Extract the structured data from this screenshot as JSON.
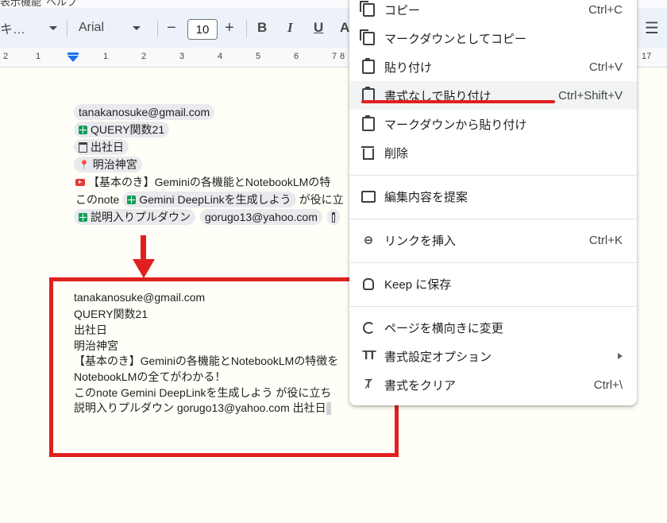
{
  "topstrip": {
    "left_text": "表示機能",
    "mid_text": "ヘルプ"
  },
  "toolbar": {
    "style_label": "キ…",
    "font_label": "Arial",
    "decrease": "−",
    "font_size": "10",
    "increase": "+",
    "bold": "B",
    "italic": "I",
    "underline": "U",
    "text_color": "A",
    "checklist_icon": "checklist-icon"
  },
  "ruler": {
    "numbers": [
      "2",
      "1",
      "1",
      "2",
      "3",
      "4",
      "5",
      "6",
      "7",
      "8",
      "17"
    ]
  },
  "document": {
    "smart_chips": {
      "email": "tanakanosuke@gmail.com",
      "sheet1": "QUERY関数21",
      "date": "出社日",
      "place": "明治神宮",
      "video": "【基本のき】Geminiの各機能とNotebookLMの特",
      "line6_prefix": "このnote",
      "doc_link": "Gemini DeepLinkを生成しよう",
      "line6_suffix": "が役に立",
      "sheet2": "説明入りプルダウン",
      "email2": "gorugo13@yahoo.com"
    },
    "pasted_lines": [
      "tanakanosuke@gmail.com",
      "QUERY関数21",
      "出社日",
      "明治神宮",
      "【基本のき】Geminiの各機能とNotebookLMの特徴を",
      "NotebookLMの全てがわかる！",
      "このnote Gemini DeepLinkを生成しよう が役に立ち",
      "説明入りプルダウン gorugo13@yahoo.com 出社日"
    ]
  },
  "context_menu": {
    "items": [
      {
        "icon": "copy-icon",
        "label": "コピー",
        "shortcut": "Ctrl+C"
      },
      {
        "icon": "markdown-copy-icon",
        "label": "マークダウンとしてコピー",
        "shortcut": ""
      },
      {
        "icon": "paste-icon",
        "label": "貼り付け",
        "shortcut": "Ctrl+V"
      },
      {
        "icon": "paste-plain-icon",
        "label": "書式なしで貼り付け",
        "shortcut": "Ctrl+Shift+V"
      },
      {
        "icon": "markdown-paste-icon",
        "label": "マークダウンから貼り付け",
        "shortcut": ""
      },
      {
        "icon": "trash-icon",
        "label": "削除",
        "shortcut": ""
      },
      {
        "icon": "suggest-edit-icon",
        "label": "編集内容を提案",
        "shortcut": ""
      },
      {
        "icon": "link-icon",
        "label": "リンクを挿入",
        "shortcut": "Ctrl+K"
      },
      {
        "icon": "keep-icon",
        "label": "Keep に保存",
        "shortcut": ""
      },
      {
        "icon": "rotate-icon",
        "label": "ページを横向きに変更",
        "shortcut": ""
      },
      {
        "icon": "format-icon",
        "label": "書式設定オプション",
        "shortcut": ""
      },
      {
        "icon": "clear-format-icon",
        "label": "書式をクリア",
        "shortcut": "Ctrl+\\"
      }
    ]
  },
  "colors": {
    "annotation_red": "#e02020",
    "toolbar_bg": "#edf2fa",
    "chip_bg": "#e8eaed"
  }
}
